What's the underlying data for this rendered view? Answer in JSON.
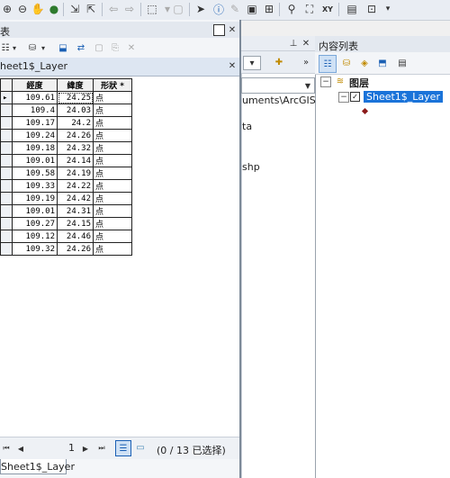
{
  "toolbar": {
    "icons": [
      "zoom-in-icon",
      "zoom-out-icon",
      "pan-icon",
      "globe-icon",
      "full-extent-icon",
      "fixed-zoom-icon",
      "back-icon",
      "forward-icon",
      "select-icon",
      "clear-icon",
      "pointer-icon",
      "info-icon",
      "edit-icon",
      "html-popup-icon",
      "measure-icon",
      "find-icon",
      "goto-xy-icon",
      "time-icon",
      "more-icon"
    ]
  },
  "table_window": {
    "title": "表",
    "layer_tab": "heet1$_Layer",
    "bottom_tab": "Sheet1$_Layer",
    "columns": [
      "經度",
      "緯度",
      "形狀 *"
    ],
    "rows": [
      [
        "109.61",
        "24.25",
        "点"
      ],
      [
        "109.4",
        "24.03",
        "点"
      ],
      [
        "109.17",
        "24.2",
        "点"
      ],
      [
        "109.24",
        "24.26",
        "点"
      ],
      [
        "109.18",
        "24.32",
        "点"
      ],
      [
        "109.01",
        "24.14",
        "点"
      ],
      [
        "109.58",
        "24.19",
        "点"
      ],
      [
        "109.33",
        "24.22",
        "点"
      ],
      [
        "109.19",
        "24.42",
        "点"
      ],
      [
        "109.01",
        "24.31",
        "点"
      ],
      [
        "109.27",
        "24.15",
        "点"
      ],
      [
        "109.12",
        "24.46",
        "点"
      ],
      [
        "109.32",
        "24.26",
        "点"
      ]
    ],
    "status": {
      "record": "1",
      "selection": "(0 / 13 已选择)"
    }
  },
  "catalog": {
    "path": "uments\\ArcGIS",
    "items": [
      "ta",
      "shp"
    ]
  },
  "toc": {
    "title": "内容列表",
    "group": "图层",
    "layer": "Sheet1$_Layer"
  },
  "colors": {
    "selection_blue": "#1a73d9",
    "point_symbol": "#8b1a1a"
  }
}
